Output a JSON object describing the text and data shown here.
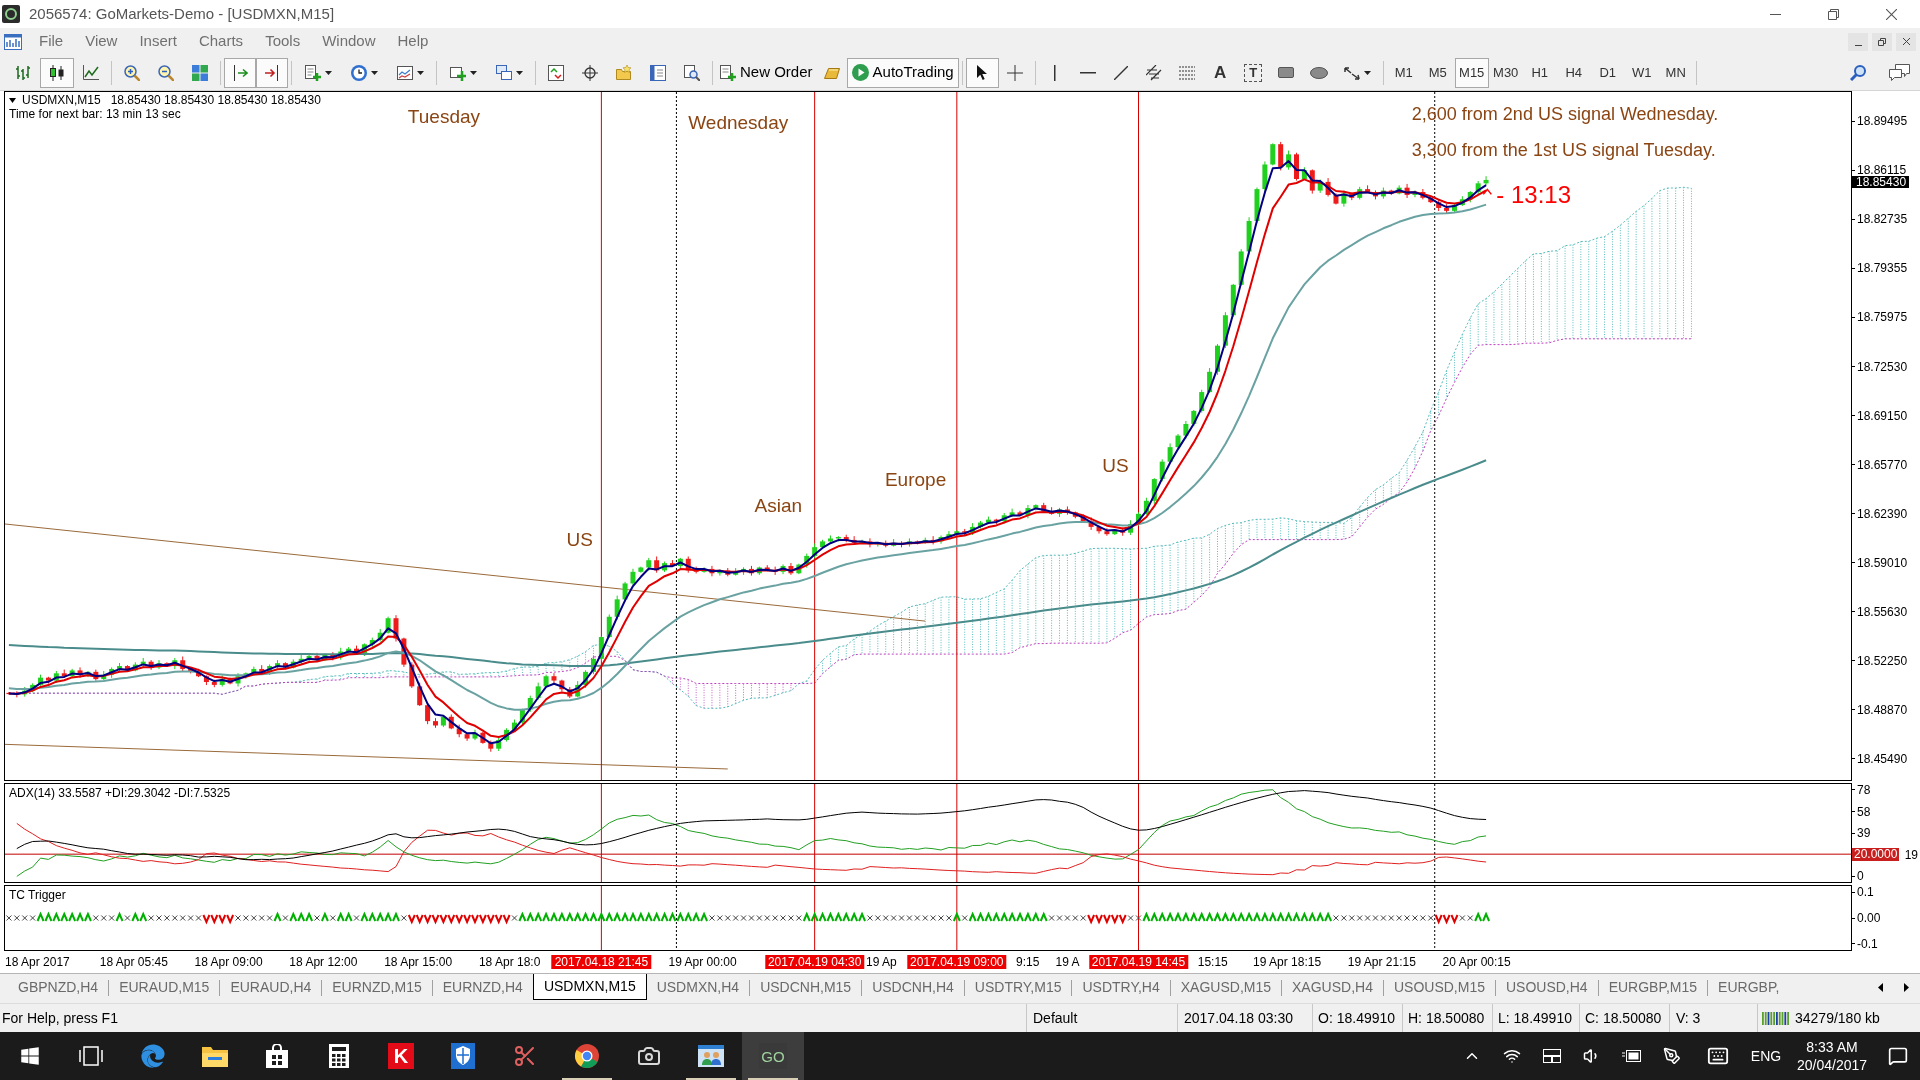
{
  "window": {
    "title": "2056574: GoMarkets-Demo - [USDMXN,M15]"
  },
  "menu": [
    "File",
    "View",
    "Insert",
    "Charts",
    "Tools",
    "Window",
    "Help"
  ],
  "toolbar": {
    "chart_types": [
      {
        "selected": false
      },
      {
        "selected": true
      },
      {
        "selected": false
      }
    ],
    "auto_scroll": {
      "on": true
    },
    "chart_shift": {
      "on": true
    },
    "new_order": {
      "label": "New Order"
    },
    "auto_trading": {
      "label": "AutoTrading",
      "on": true
    },
    "pointer_tools": [
      {
        "selected": true
      },
      {
        "selected": false
      }
    ],
    "text_tool": {
      "label": "A"
    },
    "label_tool": {
      "label": "T"
    },
    "timeframes": [
      {
        "label": "M1",
        "selected": false
      },
      {
        "label": "M5",
        "selected": false
      },
      {
        "label": "M15",
        "selected": true
      },
      {
        "label": "M30",
        "selected": false
      },
      {
        "label": "H1",
        "selected": false
      },
      {
        "label": "H4",
        "selected": false
      },
      {
        "label": "D1",
        "selected": false
      },
      {
        "label": "W1",
        "selected": false
      },
      {
        "label": "MN",
        "selected": false
      }
    ]
  },
  "chart": {
    "symbol": "USDMXN,M15",
    "prices": "18.85430 18.85430 18.85430 18.85430",
    "timer": "Time for next bar: 13 min 13 sec",
    "current_price": "18.85430",
    "price_scale": [
      "18.89495",
      "18.86115",
      "18.82735",
      "18.79355",
      "18.75975",
      "18.72530",
      "18.69150",
      "18.65770",
      "18.62390",
      "18.59010",
      "18.55630",
      "18.52250",
      "18.48870",
      "18.45490"
    ],
    "overlays": [
      {
        "kind": "cloud"
      },
      {
        "kind": "long_ma",
        "color": "#4a8c8c"
      },
      {
        "kind": "slow_ma",
        "color": "#6aa2a2"
      },
      {
        "kind": "medium_ma",
        "color": "#e00000"
      },
      {
        "kind": "fast_ma",
        "color": "#000080"
      }
    ],
    "annotations": [
      {
        "kind": "label",
        "text": "Tuesday",
        "color": "#8b4513"
      },
      {
        "kind": "label",
        "text": "Wednesday",
        "color": "#8b4513"
      },
      {
        "kind": "label",
        "text": "US",
        "color": "#8b4513"
      },
      {
        "kind": "label",
        "text": "Asian",
        "color": "#8b4513"
      },
      {
        "kind": "label",
        "text": "Europe",
        "color": "#8b4513"
      },
      {
        "kind": "label",
        "text": "US",
        "color": "#8b4513"
      },
      {
        "kind": "note",
        "text": "2,600 from 2nd US signal Wednesday.",
        "color": "#8b4513"
      },
      {
        "kind": "note",
        "text": "3,300 from the 1st US signal Tuesday.",
        "color": "#8b4513"
      },
      {
        "kind": "countdown",
        "text": "- 13:13",
        "color": "#ff0000"
      }
    ]
  },
  "adx": {
    "title": "ADX(14) 33.5587 +DI:29.3042 -DI:7.5325",
    "scale": [
      "78",
      "58",
      "39",
      "19",
      "0"
    ],
    "level_label": "20.0000"
  },
  "tc_trigger": {
    "title": "TC Trigger",
    "scale": [
      "0.1",
      "0.00",
      "-0.1"
    ]
  },
  "time_axis": {
    "labels": [
      "18 Apr 2017",
      "18 Apr 05:45",
      "18 Apr 09:00",
      "18 Apr 12:00",
      "18 Apr 15:00",
      "18 Apr 18:0",
      "19 Apr 00:00",
      "19 Ap",
      "9:15",
      "19 A",
      "15:15",
      "19 Apr 18:15",
      "19 Apr 21:15",
      "20 Apr 00:15"
    ],
    "markers": [
      "2017.04.18 21:45",
      "2017.04.19 04:30",
      "2017.04.19 09:00",
      "2017.04.19 14:45"
    ]
  },
  "tabs": [
    {
      "label": "GBPNZD,H4",
      "selected": false
    },
    {
      "label": "EURAUD,M15",
      "selected": false
    },
    {
      "label": "EURAUD,H4",
      "selected": false
    },
    {
      "label": "EURNZD,M15",
      "selected": false
    },
    {
      "label": "EURNZD,H4",
      "selected": false
    },
    {
      "label": "USDMXN,M15",
      "selected": true
    },
    {
      "label": "USDMXN,H4",
      "selected": false
    },
    {
      "label": "USDCNH,M15",
      "selected": false
    },
    {
      "label": "USDCNH,H4",
      "selected": false
    },
    {
      "label": "USDTRY,M15",
      "selected": false
    },
    {
      "label": "USDTRY,H4",
      "selected": false
    },
    {
      "label": "XAGUSD,M15",
      "selected": false
    },
    {
      "label": "XAGUSD,H4",
      "selected": false
    },
    {
      "label": "USOUSD,M15",
      "selected": false
    },
    {
      "label": "USOUSD,H4",
      "selected": false
    },
    {
      "label": "EURGBP,M15",
      "selected": false
    },
    {
      "label": "EURGBP,",
      "selected": false
    }
  ],
  "status_bar": {
    "help": "For Help, press F1",
    "profile": "Default",
    "time": "2017.04.18 03:30",
    "open": "O: 18.49910",
    "high": "H: 18.50080",
    "low": "L: 18.49910",
    "close": "C: 18.50080",
    "volume": "V: 3",
    "traffic": "34279/180 kb"
  },
  "taskbar": {
    "apps": [
      {
        "running": false,
        "selected": false
      },
      {
        "running": false,
        "selected": false
      },
      {
        "running": false,
        "selected": false
      },
      {
        "running": false,
        "selected": false
      },
      {
        "glyph": "K",
        "running": false,
        "selected": false
      },
      {
        "running": false,
        "selected": false
      },
      {
        "running": false,
        "selected": false
      },
      {
        "running": true,
        "selected": false
      },
      {
        "running": false,
        "selected": false
      },
      {
        "running": true,
        "selected": false
      },
      {
        "glyph": "GO",
        "running": true,
        "selected": true
      }
    ],
    "language": "ENG",
    "time": "8:33 AM",
    "date": "20/04/2017"
  }
}
